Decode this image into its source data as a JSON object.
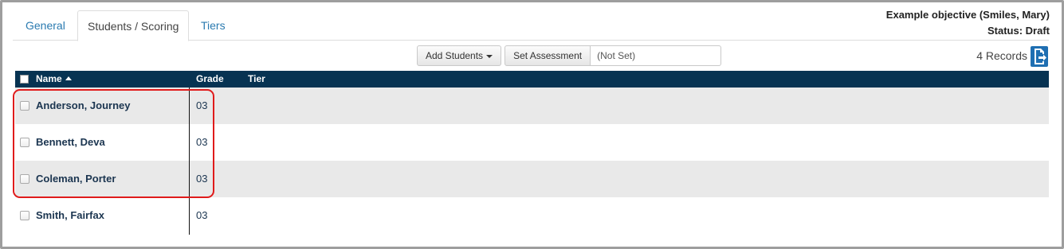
{
  "tabs": [
    {
      "label": "General",
      "active": false
    },
    {
      "label": "Students / Scoring",
      "active": true
    },
    {
      "label": "Tiers",
      "active": false
    }
  ],
  "objective": {
    "title": "Example objective (Smiles, Mary)",
    "status": "Status: Draft"
  },
  "toolbar": {
    "add_students_label": "Add Students",
    "set_assessment_label": "Set Assessment",
    "assessment_value": "(Not Set)"
  },
  "records_label": "4 Records",
  "table": {
    "headers": {
      "name": "Name",
      "grade": "Grade",
      "tier": "Tier"
    },
    "rows": [
      {
        "name": "Anderson, Journey",
        "grade": "03",
        "tier": ""
      },
      {
        "name": "Bennett, Deva",
        "grade": "03",
        "tier": ""
      },
      {
        "name": "Coleman, Porter",
        "grade": "03",
        "tier": ""
      },
      {
        "name": "Smith, Fairfax",
        "grade": "03",
        "tier": ""
      }
    ]
  },
  "colors": {
    "header_bg": "#073352",
    "link": "#2a7ab0",
    "highlight": "#e01b1b",
    "export_icon": "#1f6fb2"
  },
  "icons": [
    "caret-down-icon",
    "sort-asc-icon",
    "export-icon",
    "checkbox"
  ]
}
